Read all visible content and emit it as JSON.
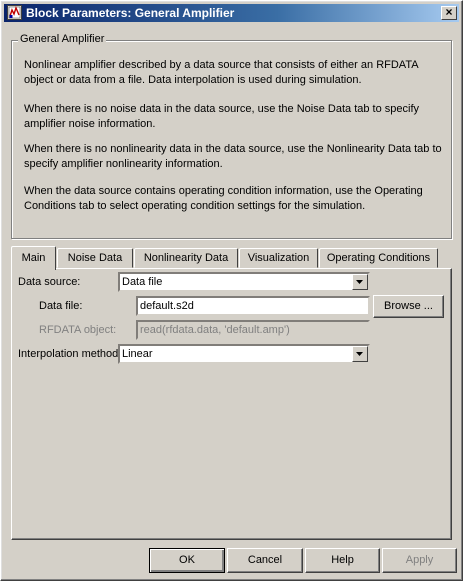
{
  "window": {
    "title": "Block Parameters: General Amplifier",
    "close_glyph": "×"
  },
  "description": {
    "legend": "General Amplifier",
    "paragraphs": [
      "Nonlinear amplifier described by a data source that consists of either an RFDATA object or data from a file. Data interpolation is used during simulation.",
      "When there is no noise data in the data source, use the Noise Data tab to specify amplifier noise information.",
      "When there is no nonlinearity data in the data source, use the Nonlinearity Data tab to specify amplifier nonlinearity information.",
      "When the data source contains operating condition information, use the Operating Conditions tab to select operating condition settings for the simulation."
    ]
  },
  "tabs": [
    "Main",
    "Noise Data",
    "Nonlinearity Data",
    "Visualization",
    "Operating Conditions"
  ],
  "active_tab": "Main",
  "main": {
    "data_source_label": "Data source:",
    "data_source_value": "Data file",
    "data_file_label": "Data file:",
    "data_file_value": "default.s2d",
    "browse_label": "Browse ...",
    "rfdata_label": "RFDATA object:",
    "rfdata_value": "read(rfdata.data, 'default.amp')",
    "interp_label": "Interpolation method:",
    "interp_value": "Linear"
  },
  "buttons": {
    "ok": "OK",
    "cancel": "Cancel",
    "help": "Help",
    "apply": "Apply"
  }
}
